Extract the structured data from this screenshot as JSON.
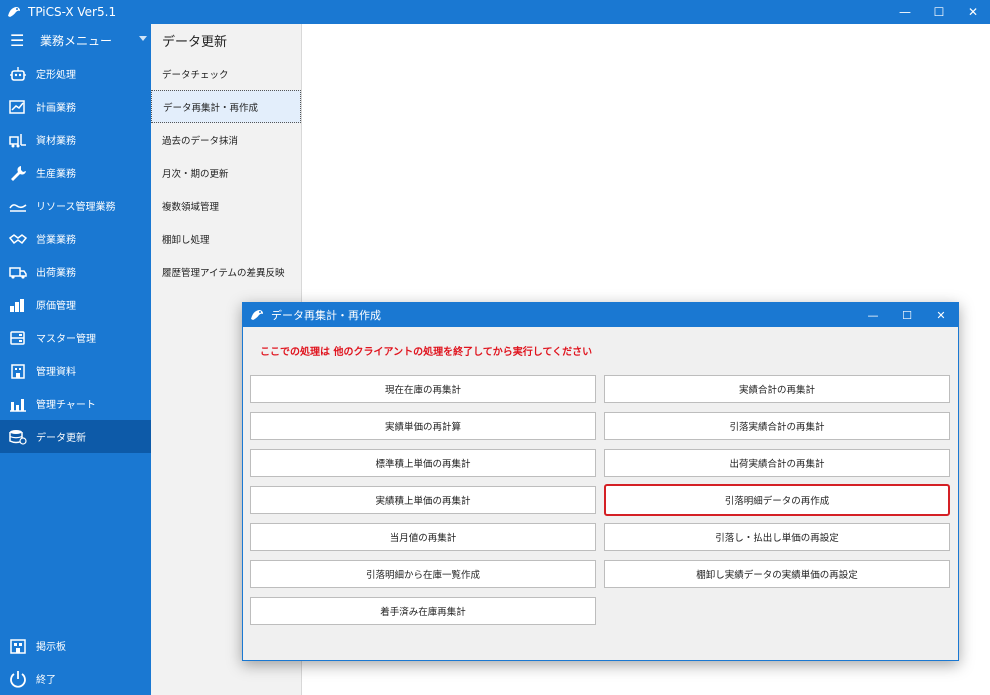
{
  "window": {
    "title": "TPiCS-X Ver5.1",
    "minimize": "—",
    "maximize": "☐",
    "close": "✕"
  },
  "sidebar": {
    "menu_label": "業務メニュー",
    "items": [
      {
        "label": "定形処理",
        "icon": "robot-icon"
      },
      {
        "label": "計画業務",
        "icon": "chart-edit-icon"
      },
      {
        "label": "資材業務",
        "icon": "forklift-icon"
      },
      {
        "label": "生産業務",
        "icon": "wrench-icon"
      },
      {
        "label": "リソース管理業務",
        "icon": "resource-icon"
      },
      {
        "label": "営業業務",
        "icon": "handshake-icon"
      },
      {
        "label": "出荷業務",
        "icon": "truck-icon"
      },
      {
        "label": "原価管理",
        "icon": "coins-icon"
      },
      {
        "label": "マスター管理",
        "icon": "master-icon"
      },
      {
        "label": "管理資料",
        "icon": "building-icon"
      },
      {
        "label": "管理チャート",
        "icon": "bar-chart-icon"
      },
      {
        "label": "データ更新",
        "icon": "database-refresh-icon",
        "active": true
      }
    ],
    "bottom": [
      {
        "label": "掲示板",
        "icon": "board-icon"
      },
      {
        "label": "終了",
        "icon": "power-icon"
      }
    ]
  },
  "submenu": {
    "title": "データ更新",
    "items": [
      {
        "label": "データチェック"
      },
      {
        "label": "データ再集計・再作成",
        "selected": true
      },
      {
        "label": "過去のデータ抹消"
      },
      {
        "label": "月次・期の更新"
      },
      {
        "label": "複数領域管理"
      },
      {
        "label": "棚卸し処理"
      },
      {
        "label": "履歴管理アイテムの差異反映"
      }
    ]
  },
  "dialog": {
    "title": "データ再集計・再作成",
    "warning": "ここでの処理は 他のクライアントの処理を終了してから実行してください",
    "left_buttons": [
      "現在在庫の再集計",
      "実績単価の再計算",
      "標準積上単価の再集計",
      "実績積上単価の再集計",
      "当月値の再集計",
      "引落明細から在庫一覧作成",
      "着手済み在庫再集計"
    ],
    "right_buttons": [
      "実績合計の再集計",
      "引落実績合計の再集計",
      "出荷実績合計の再集計",
      "引落明細データの再作成",
      "引落し・払出し単価の再設定",
      "棚卸し実績データの実績単価の再設定"
    ],
    "highlighted": "引落明細データの再作成"
  },
  "colors": {
    "accent": "#1a78d2",
    "active": "#0d5aa8",
    "warning": "#e0141e",
    "highlight_border": "#d42025"
  }
}
